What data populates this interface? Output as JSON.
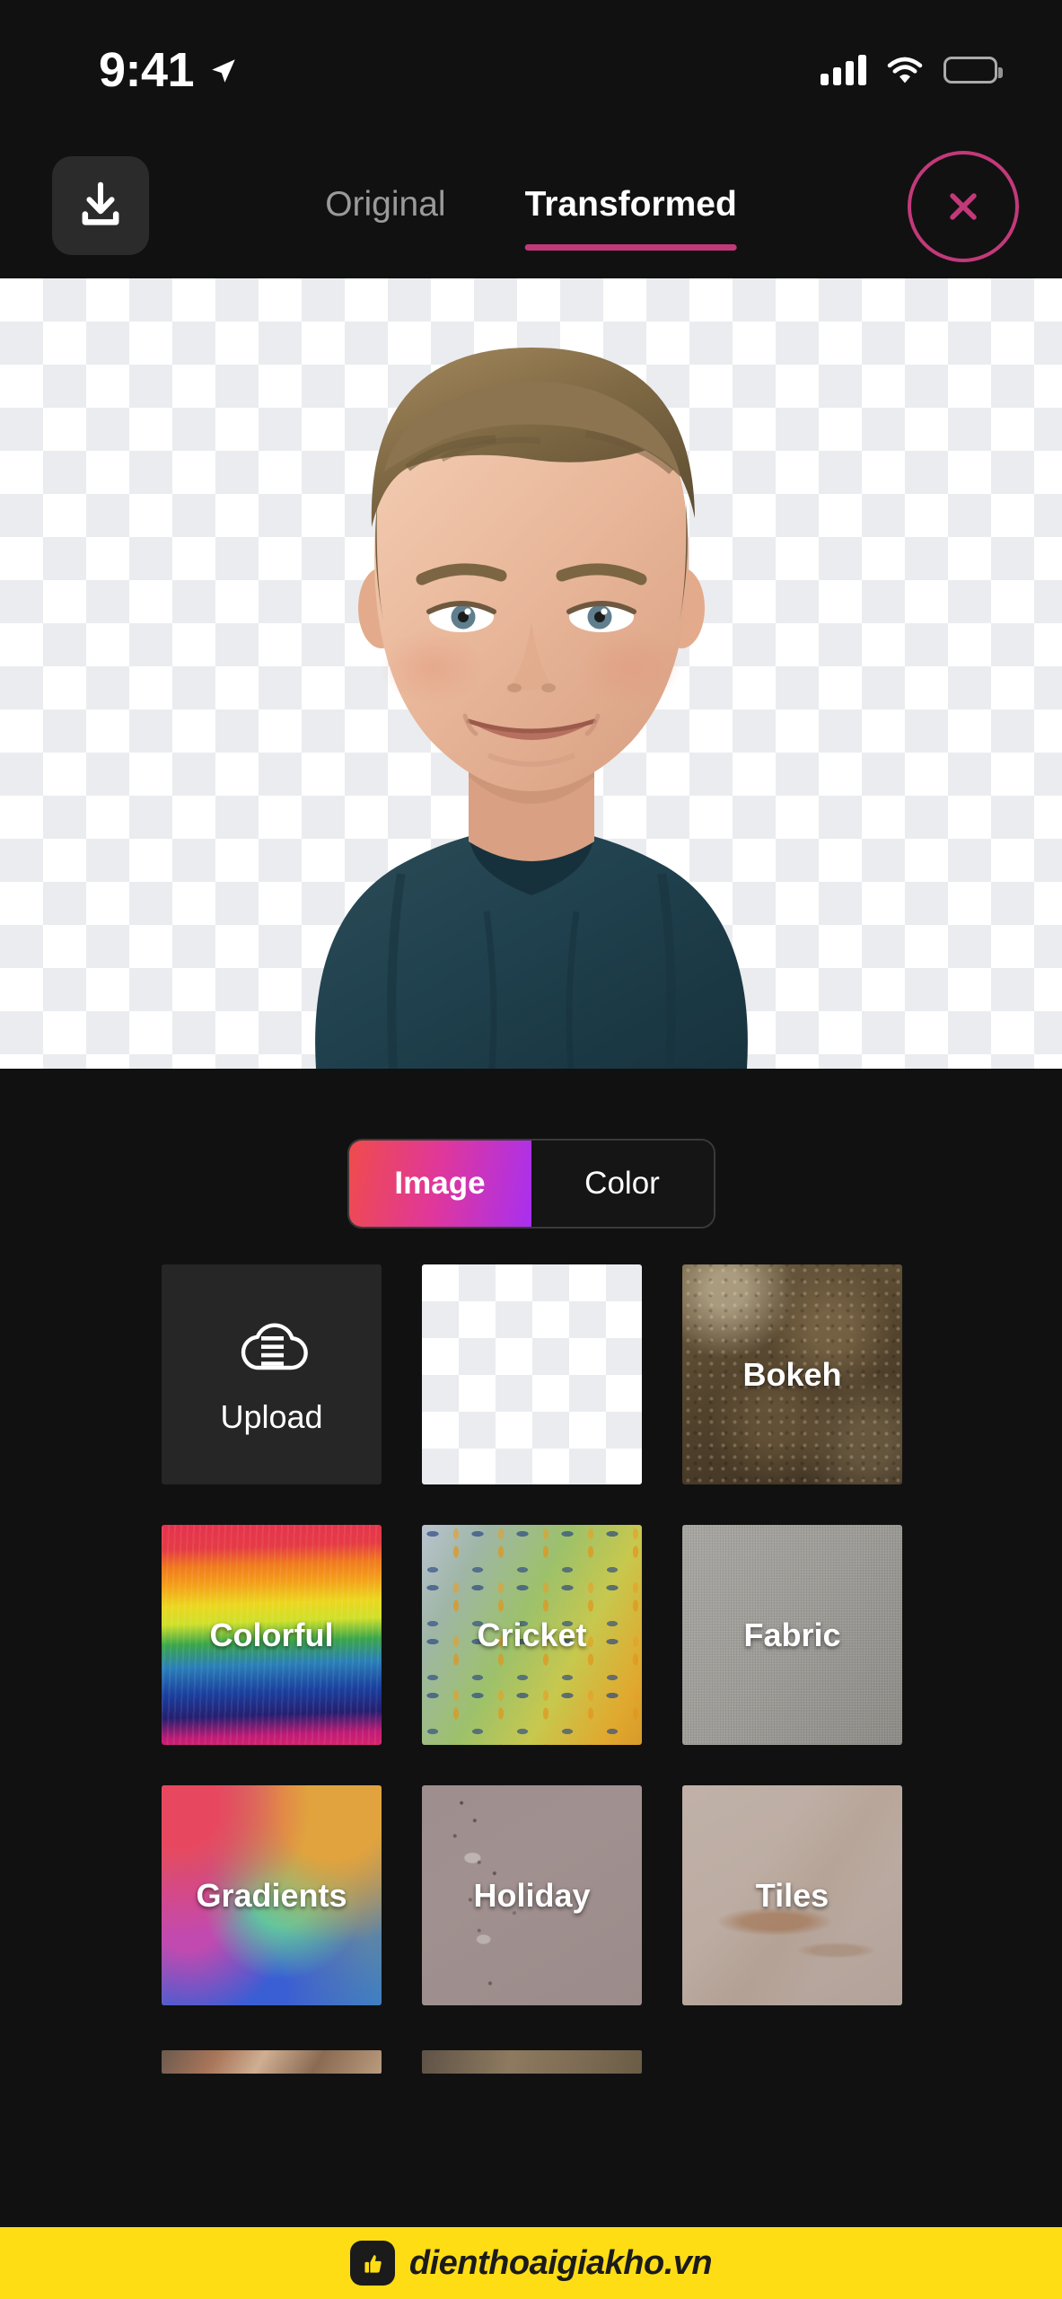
{
  "status_bar": {
    "time": "9:41",
    "location_icon": "location-arrow-icon",
    "signal_icon": "cellular-signal-icon",
    "wifi_icon": "wifi-icon",
    "battery_icon": "battery-full-icon"
  },
  "toolbar": {
    "download_icon": "download-icon",
    "close_icon": "close-x-icon",
    "accent_color": "#c2397a",
    "tabs": [
      {
        "label": "Original",
        "active": false
      },
      {
        "label": "Transformed",
        "active": true
      }
    ]
  },
  "preview": {
    "background": "transparent-checkerboard",
    "subject": "cutout-portrait-photo"
  },
  "panel": {
    "segmented_control": {
      "options": [
        {
          "label": "Image",
          "selected": true
        },
        {
          "label": "Color",
          "selected": false
        }
      ],
      "active_gradient_from": "#ef4c4c",
      "active_gradient_to": "#a830f0"
    },
    "background_tiles": [
      {
        "label": "Upload",
        "kind": "upload",
        "icon": "cloud-upload-icon"
      },
      {
        "label": "",
        "kind": "checker"
      },
      {
        "label": "Bokeh",
        "kind": "bokeh"
      },
      {
        "label": "Colorful",
        "kind": "colorful"
      },
      {
        "label": "Cricket",
        "kind": "cricket"
      },
      {
        "label": "Fabric",
        "kind": "fabric"
      },
      {
        "label": "Gradients",
        "kind": "gradients"
      },
      {
        "label": "Holiday",
        "kind": "holiday"
      },
      {
        "label": "Tiles",
        "kind": "tiles"
      }
    ]
  },
  "watermark": {
    "text": "dienthoaigiakho.vn",
    "logo_icon": "thumbs-up-logo-icon",
    "background_color": "#ffdd15"
  }
}
